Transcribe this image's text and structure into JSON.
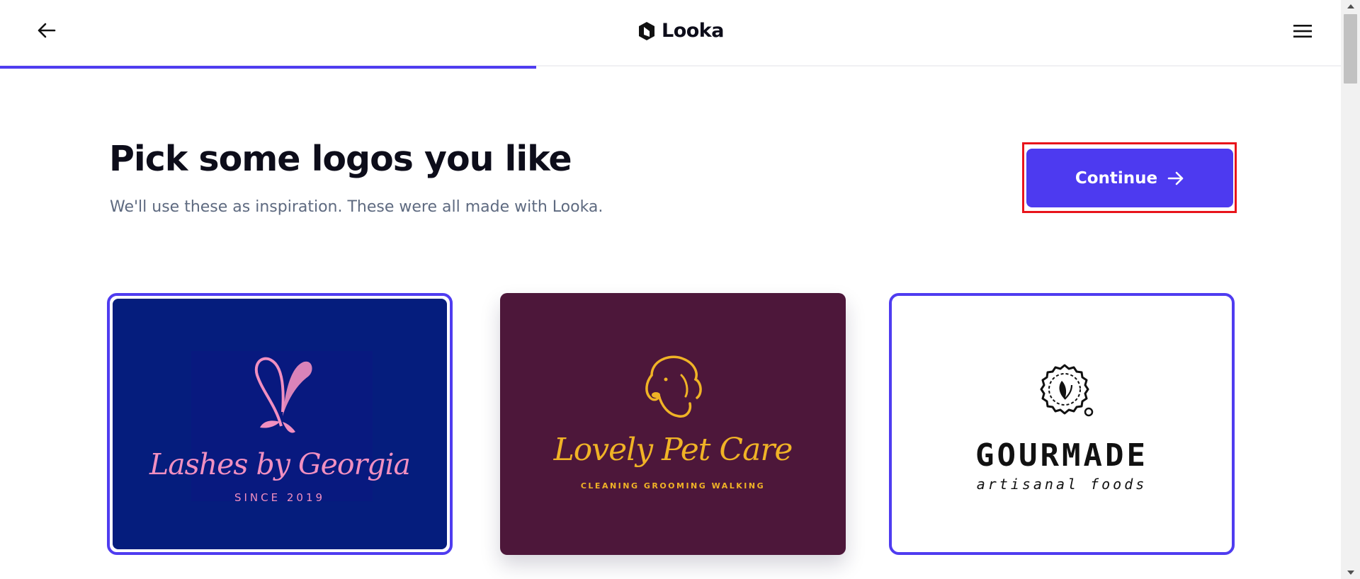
{
  "app": {
    "brand_name": "Looka"
  },
  "header": {
    "back_icon": "arrow-left-icon",
    "logo_icon": "looka-mark-icon",
    "menu_icon": "hamburger-menu-icon",
    "progress_fraction": 0.4
  },
  "page": {
    "title": "Pick some logos you like",
    "subtitle": "We'll use these as inspiration. These were all made with Looka."
  },
  "actions": {
    "continue_label": "Continue",
    "continue_icon": "arrow-right-icon"
  },
  "logos": [
    {
      "brand": "Lashes by Georgia",
      "tagline": "SINCE 2019",
      "selected": true,
      "background": "#051d7d",
      "accent": "#f18fc0",
      "icon": "butterfly-icon"
    },
    {
      "brand": "Lovely Pet Care",
      "tagline": "CLEANING  GROOMING  WALKING",
      "selected": false,
      "background": "#4d173a",
      "accent": "#f0b326",
      "icon": "dog-head-icon"
    },
    {
      "brand": "GOURMADE",
      "tagline": "artisanal foods",
      "selected": true,
      "background": "#ffffff",
      "accent": "#111111",
      "icon": "leaf-badge-icon"
    }
  ],
  "colors": {
    "accent": "#4f3cf0",
    "highlight_outline": "#e8141b",
    "text": "#0d0d1a",
    "muted_text": "#5e6a80"
  }
}
